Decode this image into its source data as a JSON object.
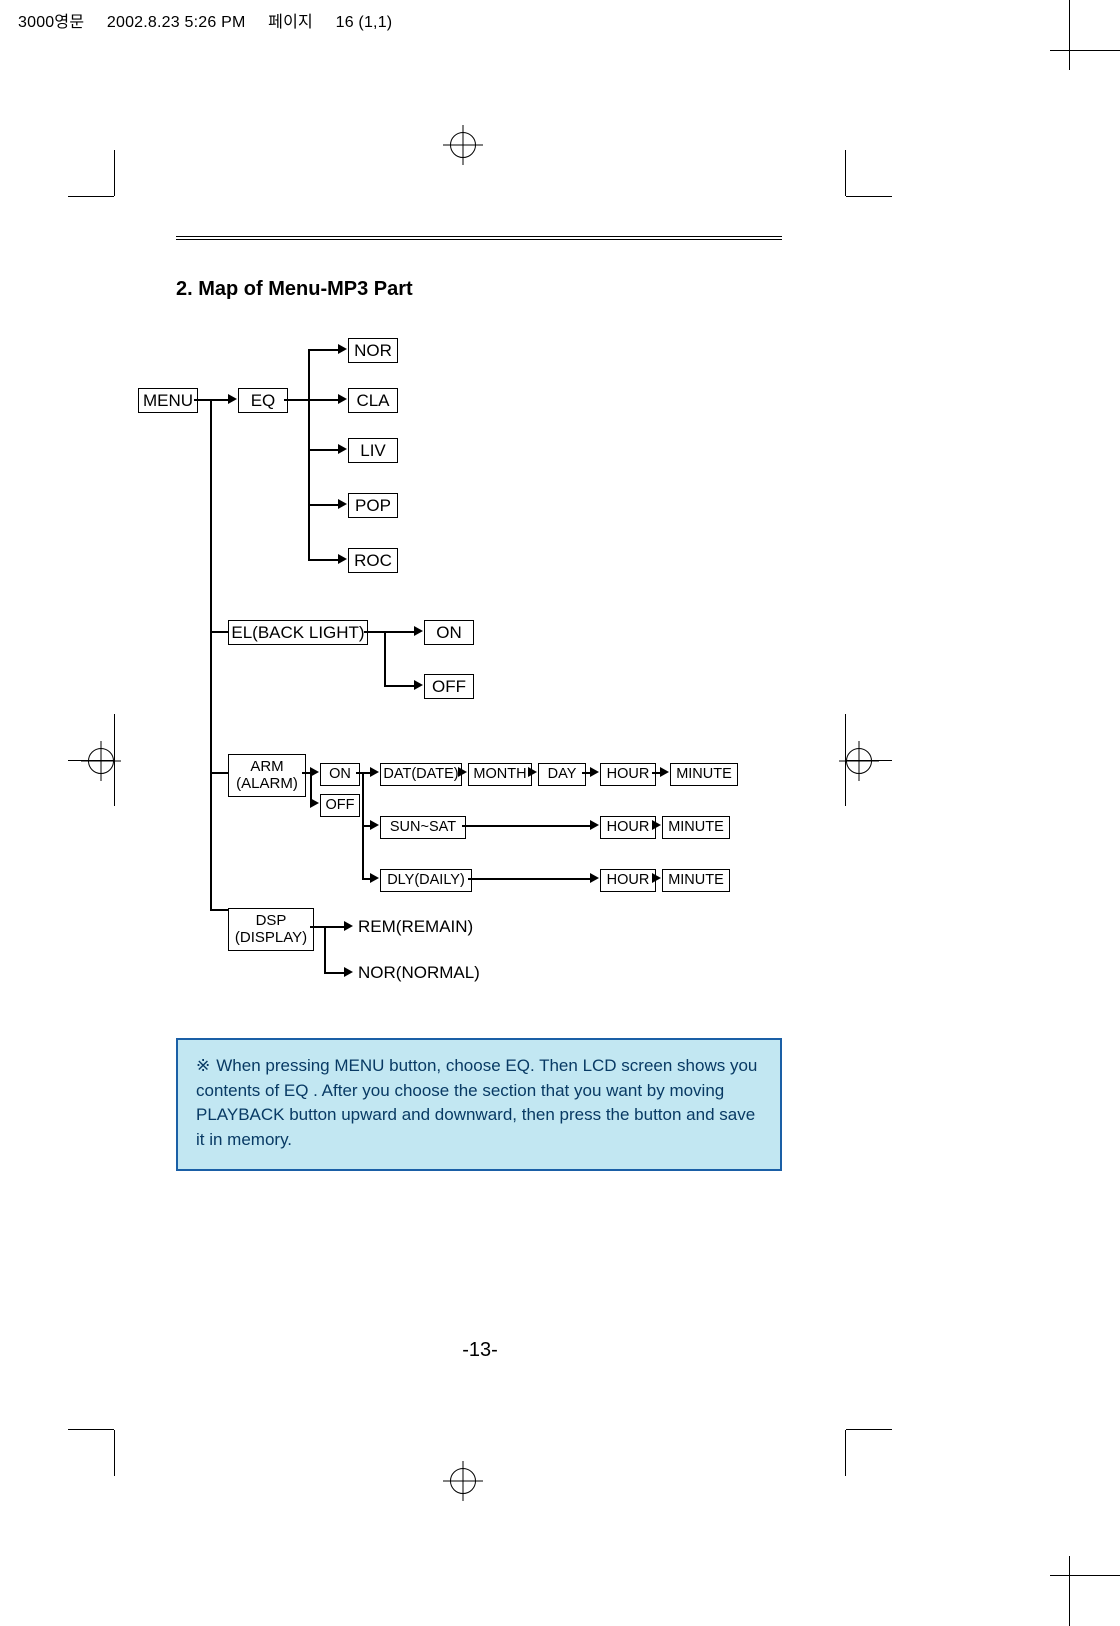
{
  "slug": {
    "doc": "3000영문",
    "date": "2002.8.23 5:26 PM",
    "page": "16 (1,1)"
  },
  "heading": "2. Map of Menu-MP3 Part",
  "menu": "MENU",
  "eq": {
    "label": "EQ",
    "options": [
      "NOR",
      "CLA",
      "LIV",
      "POP",
      "ROC"
    ]
  },
  "el": {
    "label": "EL(BACK LIGHT)",
    "on": "ON",
    "off": "OFF"
  },
  "arm": {
    "label_top": "ARM",
    "label_bot": "(ALARM)",
    "on": "ON",
    "off": "OFF",
    "dat": "DAT(DATE)",
    "month": "MONTH",
    "day": "DAY",
    "hour": "HOUR",
    "minute": "MINUTE",
    "sunsat": "SUN~SAT",
    "dly": "DLY(DAILY)"
  },
  "dsp": {
    "label_top": "DSP",
    "label_bot": "(DISPLAY)",
    "rem": "REM(REMAIN)",
    "nor": "NOR(NORMAL)"
  },
  "note": "When pressing MENU button, choose EQ. Then LCD screen shows you contents of EQ . After you choose the section that you want by moving PLAYBACK button upward and downward, then press the button and save it in memory.",
  "page_number": "-13-"
}
